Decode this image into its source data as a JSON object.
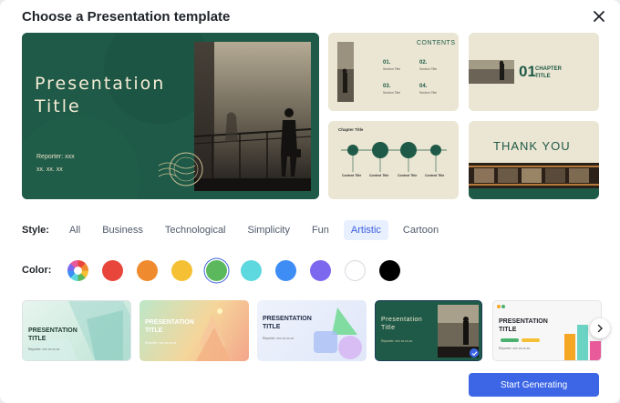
{
  "dialog": {
    "title": "Choose a Presentation template",
    "close_icon": "close-icon"
  },
  "preview": {
    "main": {
      "title_line1": "Presentation",
      "title_line2": "Title",
      "reporter": "Reporter: xxx",
      "date": "xx. xx. xx"
    },
    "contents": {
      "heading": "CONTENTS",
      "items": [
        {
          "num": "01.",
          "label": "Section Title"
        },
        {
          "num": "02.",
          "label": "Section Title"
        },
        {
          "num": "03.",
          "label": "Section Title"
        },
        {
          "num": "04.",
          "label": "Section Title"
        }
      ]
    },
    "chapter": {
      "num": "01",
      "line1": "CHAPTER",
      "line2": "TITLE"
    },
    "chapter_title": {
      "heading": "Chapter Title",
      "items": [
        "Content Title",
        "Content Title",
        "Content Title",
        "Content Title"
      ]
    },
    "thanks": {
      "text": "THANK YOU"
    }
  },
  "style": {
    "label": "Style:",
    "tabs": [
      "All",
      "Business",
      "Technological",
      "Simplicity",
      "Fun",
      "Artistic",
      "Cartoon"
    ],
    "selected": "Artistic"
  },
  "color": {
    "label": "Color:",
    "swatches": [
      "multicolor",
      "#e8463a",
      "#f08a2e",
      "#f5c033",
      "#5cb85c",
      "#5ed8df",
      "#3d8df5",
      "#7b68ee",
      "#ffffff",
      "#000000"
    ],
    "selected_index": 4
  },
  "templates": [
    {
      "title": "PRESENTATION\nTITLE",
      "sub": "Reporter: xxx   xx.xx.xx"
    },
    {
      "title": "PRESENTATION\nTITLE",
      "sub": "Reporter: xxx   xx.xx.xx"
    },
    {
      "title": "PRESENTATION\nTITLE",
      "sub": "Reporter: xxx   xx.xx.xx"
    },
    {
      "title": "Presentation\nTitle",
      "sub": "Reporter: xxx   xx.xx.xx"
    },
    {
      "title": "PRESENTATION\nTITLE",
      "sub": "Reporter: xxx   xx.xx.xx"
    }
  ],
  "actions": {
    "start": "Start Generating"
  }
}
